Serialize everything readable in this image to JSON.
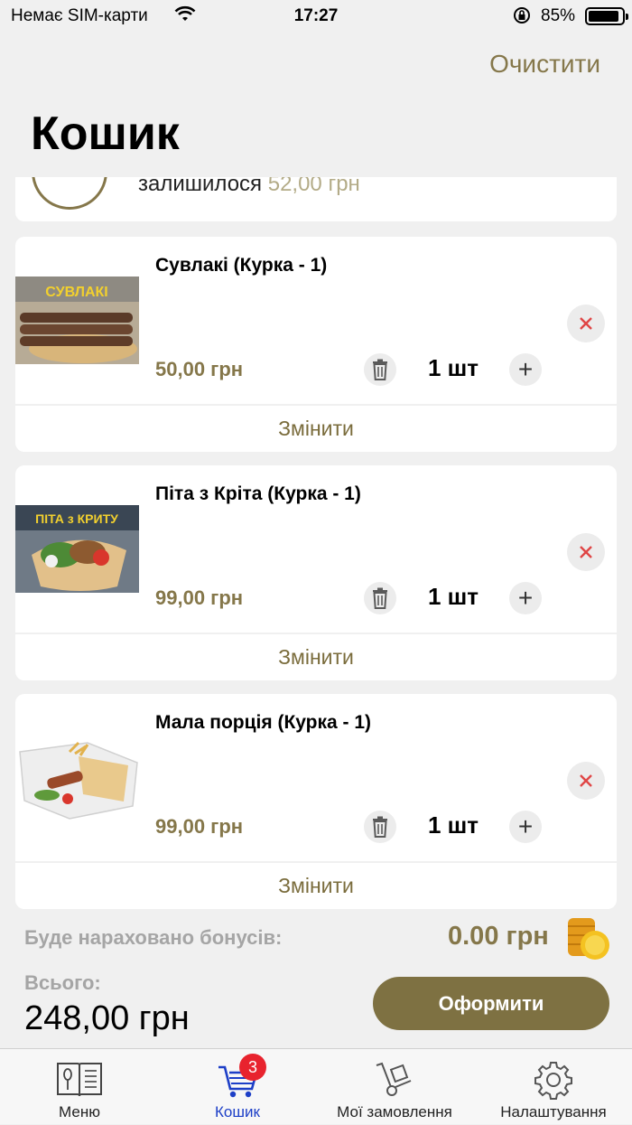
{
  "status_bar": {
    "carrier": "Немає SIM-карти",
    "time": "17:27",
    "battery_percent": "85%"
  },
  "header": {
    "clear_label": "Очистити",
    "title": "Кошик"
  },
  "promo": {
    "text": "залишилося",
    "amount": "52,00 грн"
  },
  "items": [
    {
      "name": "Сувлакі (Курка - 1)",
      "price": "50,00 грн",
      "qty": "1 шт",
      "change_label": "Змінити",
      "image_caption": "СУВЛАКІ"
    },
    {
      "name": "Піта з Кріта (Курка - 1)",
      "price": "99,00 грн",
      "qty": "1 шт",
      "change_label": "Змінити",
      "image_caption": "ПІТА з КРИТУ"
    },
    {
      "name": "Мала порція (Курка - 1)",
      "price": "99,00 грн",
      "qty": "1 шт",
      "change_label": "Змінити"
    }
  ],
  "summary": {
    "bonus_label": "Буде нараховано бонусів:",
    "bonus_amount": "0.00 грн",
    "total_label": "Всього:",
    "total_value": "248,00 грн",
    "checkout_label": "Оформити"
  },
  "tabbar": {
    "tabs": [
      {
        "label": "Меню",
        "icon": "menu-book-icon",
        "active": false
      },
      {
        "label": "Кошик",
        "icon": "cart-icon",
        "active": true
      },
      {
        "label": "Мої замовлення",
        "icon": "hand-truck-icon",
        "active": false
      },
      {
        "label": "Налаштування",
        "icon": "gear-icon",
        "active": false
      }
    ],
    "cart_badge": "3"
  },
  "colors": {
    "accent": "#85774a",
    "button": "#7e7142",
    "active_tab": "#1d3fc7",
    "badge": "#e8232e",
    "remove_x": "#e04545"
  }
}
